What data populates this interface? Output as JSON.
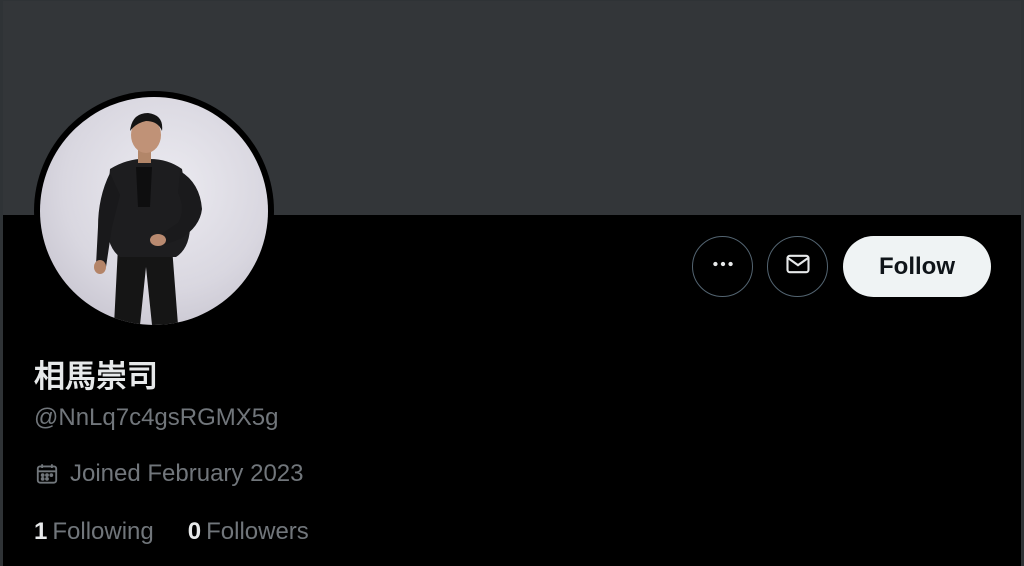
{
  "profile": {
    "display_name": "相馬崇司",
    "handle": "@NnLq7c4gsRGMX5g",
    "joined": "Joined February 2023",
    "following_count": "1",
    "following_label": "Following",
    "followers_count": "0",
    "followers_label": "Followers"
  },
  "actions": {
    "more_icon": "more-horizontal-icon",
    "message_icon": "envelope-icon",
    "follow_label": "Follow"
  },
  "colors": {
    "background": "#000000",
    "banner": "#333639",
    "primary_text": "#e7e9ea",
    "secondary_text": "#71767b",
    "button_border": "#536471",
    "follow_bg": "#eff3f4"
  }
}
